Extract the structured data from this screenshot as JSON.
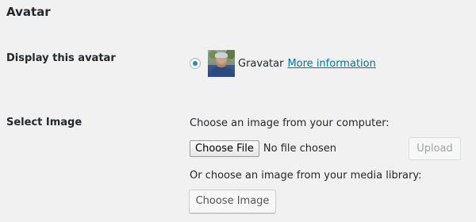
{
  "section": {
    "title": "Avatar"
  },
  "display_avatar": {
    "label": "Display this avatar",
    "option_label": "Gravatar",
    "more_info_link": "More information",
    "selected": true
  },
  "select_image": {
    "label": "Select Image",
    "computer_prompt": "Choose an image from your computer:",
    "file_button_label": "Choose File",
    "file_status": "No file chosen",
    "upload_button_label": "Upload",
    "media_prompt": "Or choose an image from your media library:",
    "choose_image_button_label": "Choose Image"
  },
  "colors": {
    "background": "#f1f1f1",
    "link": "#0073aa",
    "radio_selected": "#1e8cbe",
    "text": "#23282d"
  },
  "icons": {
    "avatar": "gravatar-avatar-photo"
  }
}
